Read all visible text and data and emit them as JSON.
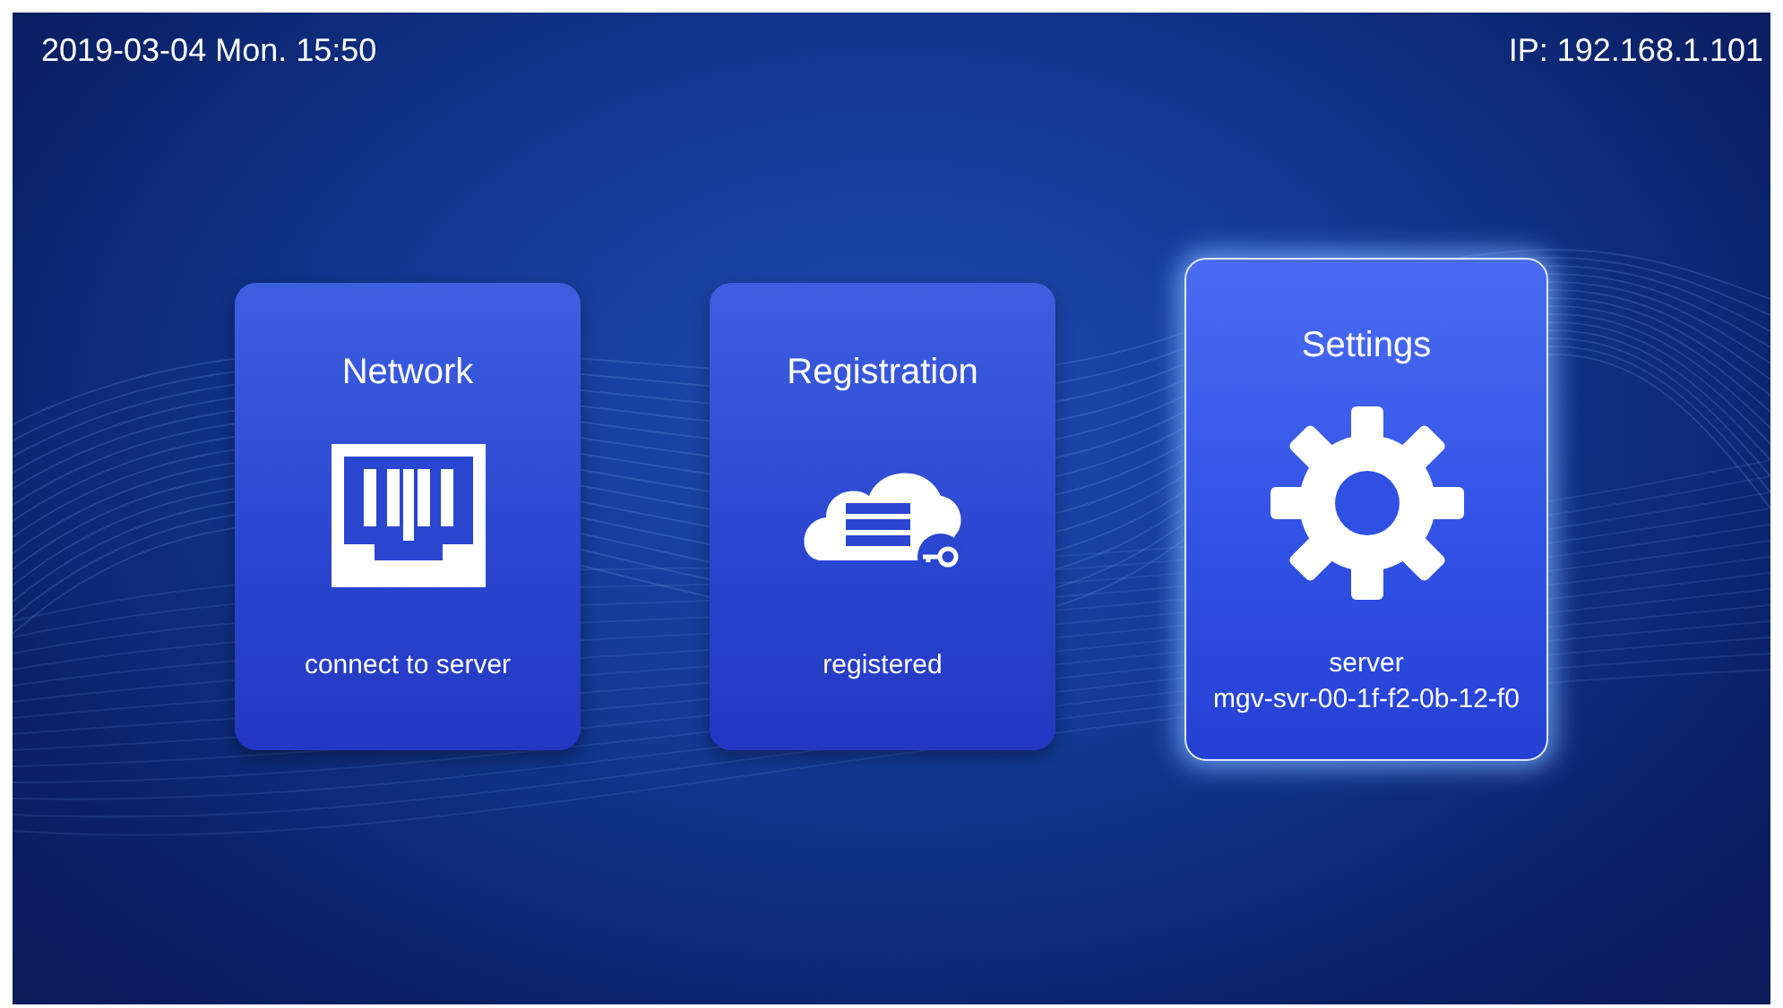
{
  "status_bar": {
    "datetime": "2019-03-04 Mon. 15:50",
    "ip": "IP: 192.168.1.101"
  },
  "tiles": [
    {
      "title": "Network",
      "kind": "network",
      "status": [
        "connect to server"
      ],
      "selected": false
    },
    {
      "title": "Registration",
      "kind": "cloud",
      "status": [
        "registered"
      ],
      "selected": false
    },
    {
      "title": "Settings",
      "kind": "gear",
      "status": [
        "server",
        "mgv-svr-00-1f-f2-0b-12-f0"
      ],
      "selected": true
    }
  ]
}
